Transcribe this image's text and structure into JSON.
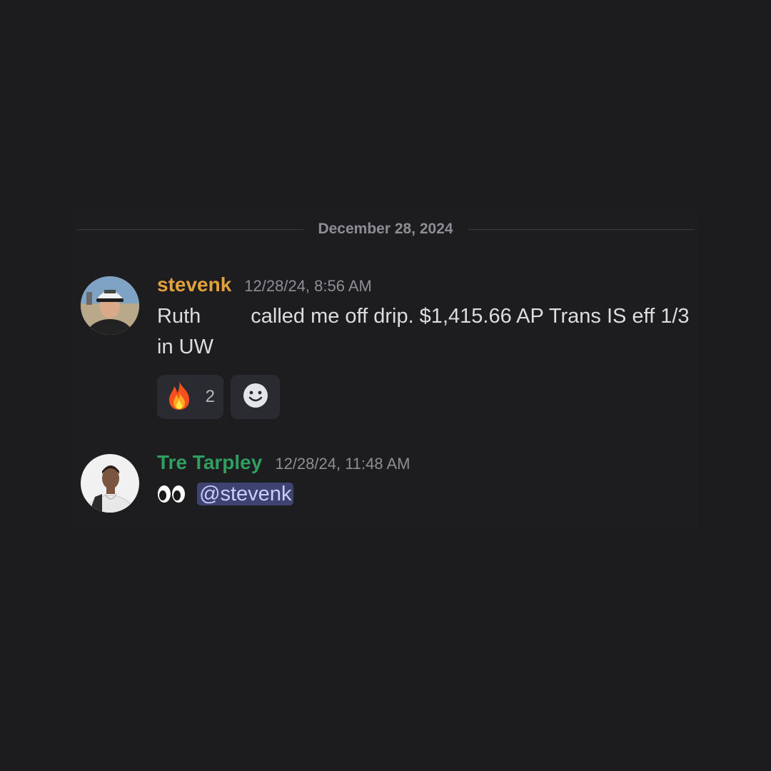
{
  "date_divider": "December 28, 2024",
  "messages": [
    {
      "username": "stevenk",
      "username_color": "#e2a13d",
      "timestamp": "12/28/24, 8:56 AM",
      "text_part1": "Ruth",
      "text_part2": "called me off drip. $1,415.66 AP Trans IS eff 1/3 in UW",
      "reactions": [
        {
          "icon": "fire-icon",
          "count": "2"
        }
      ],
      "add_reaction_icon": "smiley-icon"
    },
    {
      "username": "Tre Tarpley",
      "username_color": "#2f9e5f",
      "timestamp": "12/28/24, 11:48 AM",
      "emoji": "eyes-icon",
      "mention": "@stevenk"
    }
  ]
}
